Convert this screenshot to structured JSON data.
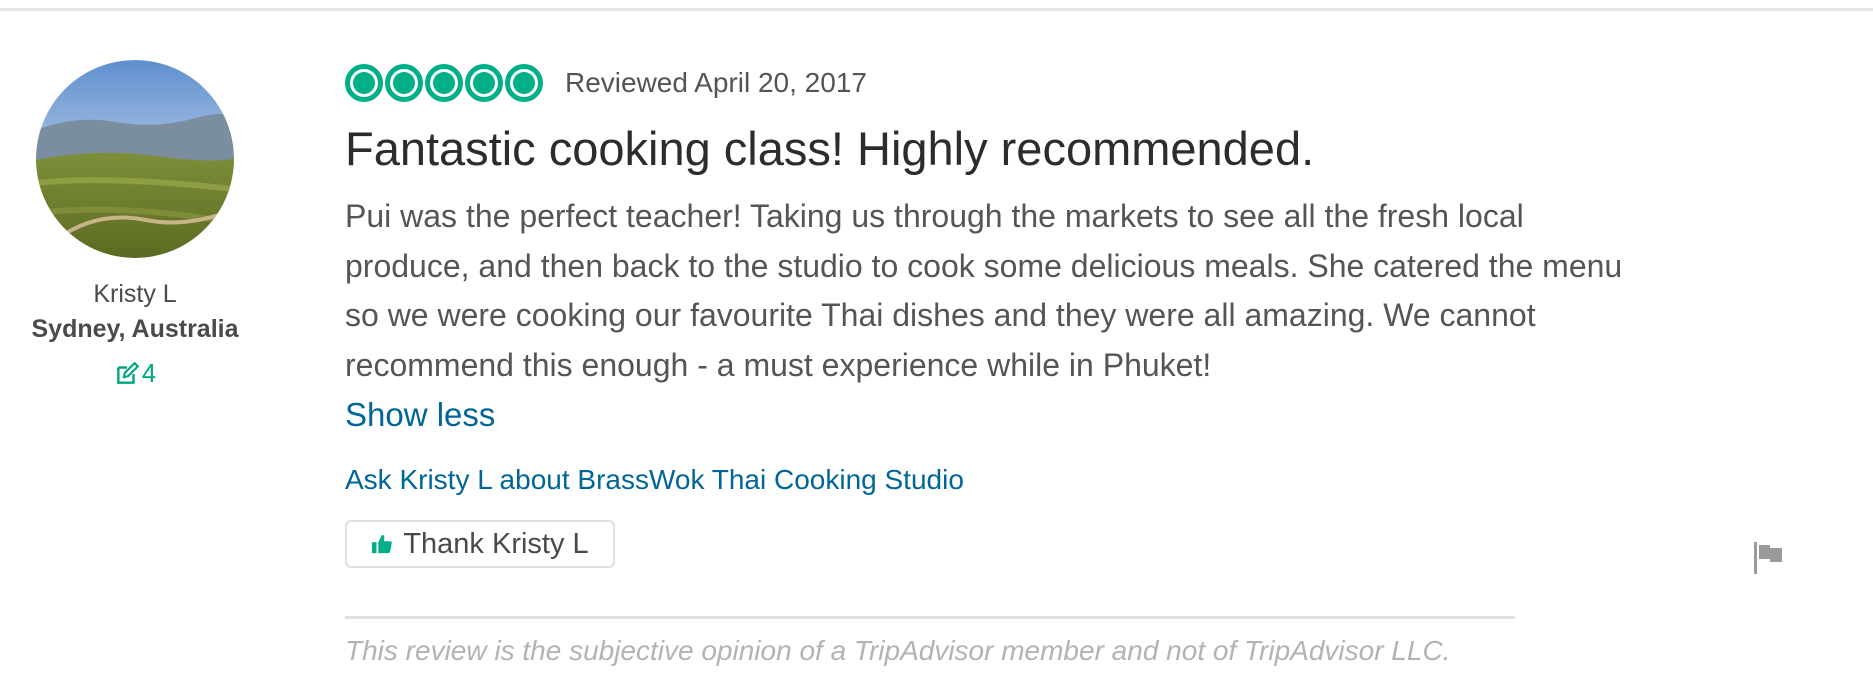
{
  "member": {
    "name": "Kristy L",
    "location": "Sydney, Australia",
    "contributions": "4",
    "icons": {
      "contributions": "edit-icon",
      "avatar": "landscape-photo"
    }
  },
  "review": {
    "rating": 5,
    "rating_max": 5,
    "date": "Reviewed April 20, 2017",
    "title": "Fantastic cooking class! Highly recommended.",
    "body": "Pui was the perfect teacher! Taking us through the markets to see all the fresh local produce, and then back to the studio to cook some delicious meals. She catered the menu so we were cooking our favourite Thai dishes and they were all amazing. We cannot recommend this enough - a must experience while in Phuket!",
    "show_less_label": "Show less",
    "ask_link": "Ask Kristy L about BrassWok Thai Cooking Studio",
    "thank_label": "Thank Kristy L"
  },
  "disclaimer": "This review is the subjective opinion of a TripAdvisor member and not of TripAdvisor LLC.",
  "colors": {
    "brand_green": "#00af87",
    "link_blue": "#006699",
    "text": "#555555",
    "muted": "#b3b3b3"
  }
}
